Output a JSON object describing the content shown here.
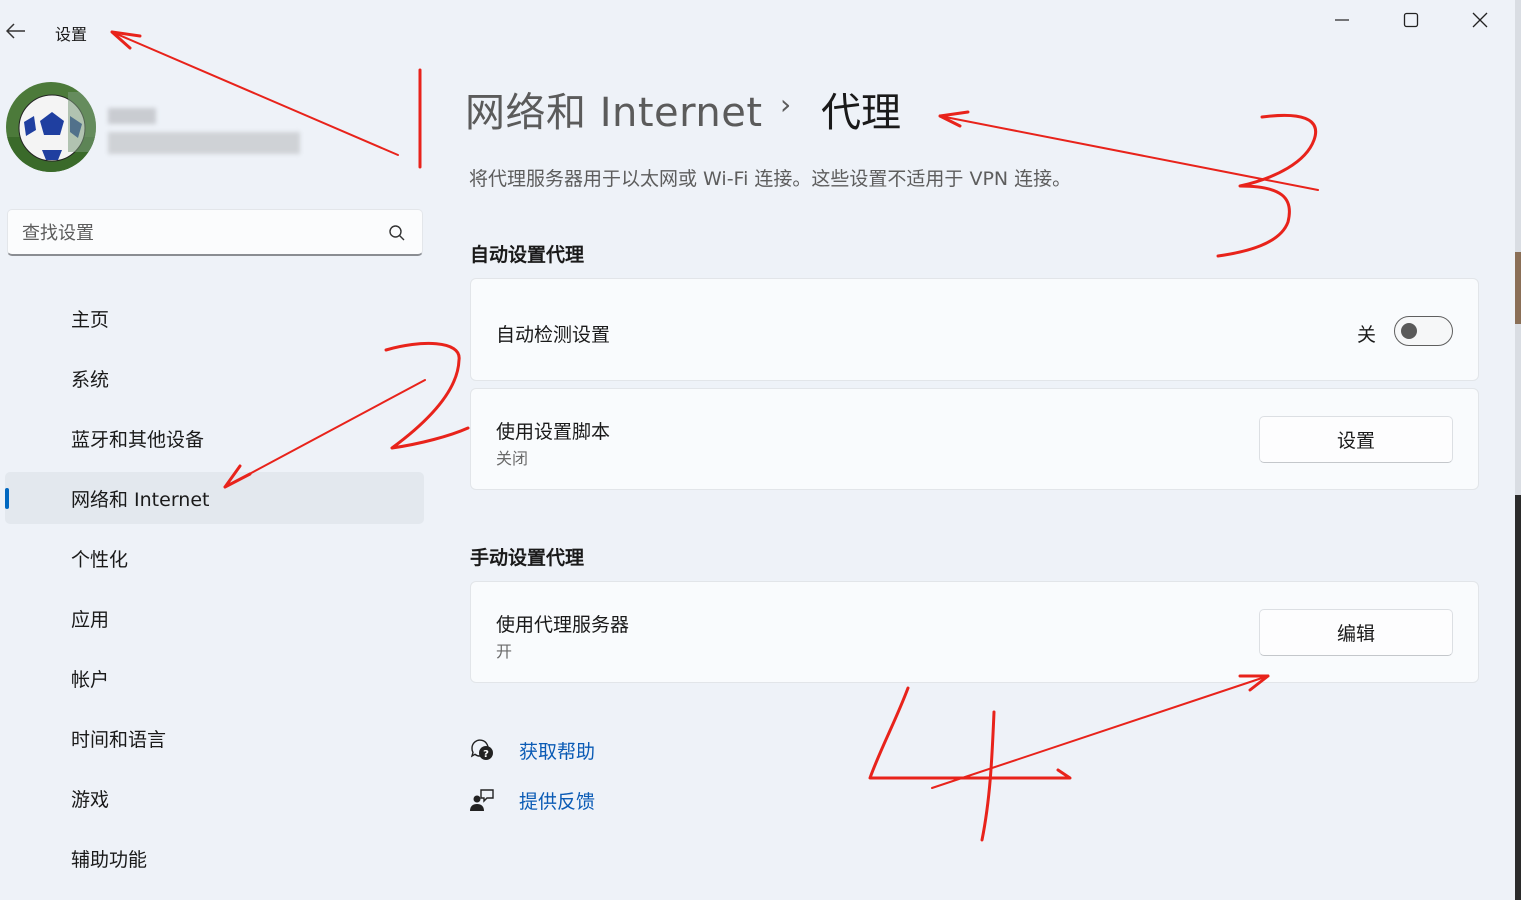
{
  "window": {
    "app_title": "设置",
    "back_label": "←"
  },
  "user": {
    "avatar": "soccer-ball-avatar"
  },
  "search": {
    "placeholder": "查找设置"
  },
  "sidebar": {
    "items": [
      {
        "label": "主页"
      },
      {
        "label": "系统"
      },
      {
        "label": "蓝牙和其他设备"
      },
      {
        "label": "网络和 Internet",
        "active": true
      },
      {
        "label": "个性化"
      },
      {
        "label": "应用"
      },
      {
        "label": "帐户"
      },
      {
        "label": "时间和语言"
      },
      {
        "label": "游戏"
      },
      {
        "label": "辅助功能"
      }
    ]
  },
  "main": {
    "breadcrumb_parent": "网络和 Internet",
    "breadcrumb_sep": "›",
    "page_title": "代理",
    "description": "将代理服务器用于以太网或 Wi-Fi 连接。这些设置不适用于 VPN 连接。",
    "auto_section": {
      "title": "自动设置代理",
      "detect": {
        "title": "自动检测设置",
        "toggle_label": "关",
        "toggle_on": false
      },
      "script": {
        "title": "使用设置脚本",
        "subtitle": "关闭",
        "button": "设置"
      }
    },
    "manual_section": {
      "title": "手动设置代理",
      "proxy": {
        "title": "使用代理服务器",
        "subtitle": "开",
        "button": "编辑"
      }
    },
    "links": {
      "help": "获取帮助",
      "feedback": "提供反馈"
    }
  },
  "colors": {
    "accent": "#0067c0",
    "link": "#0a5bb5",
    "annotation": "#e8231b",
    "background": "#eef2f8"
  }
}
